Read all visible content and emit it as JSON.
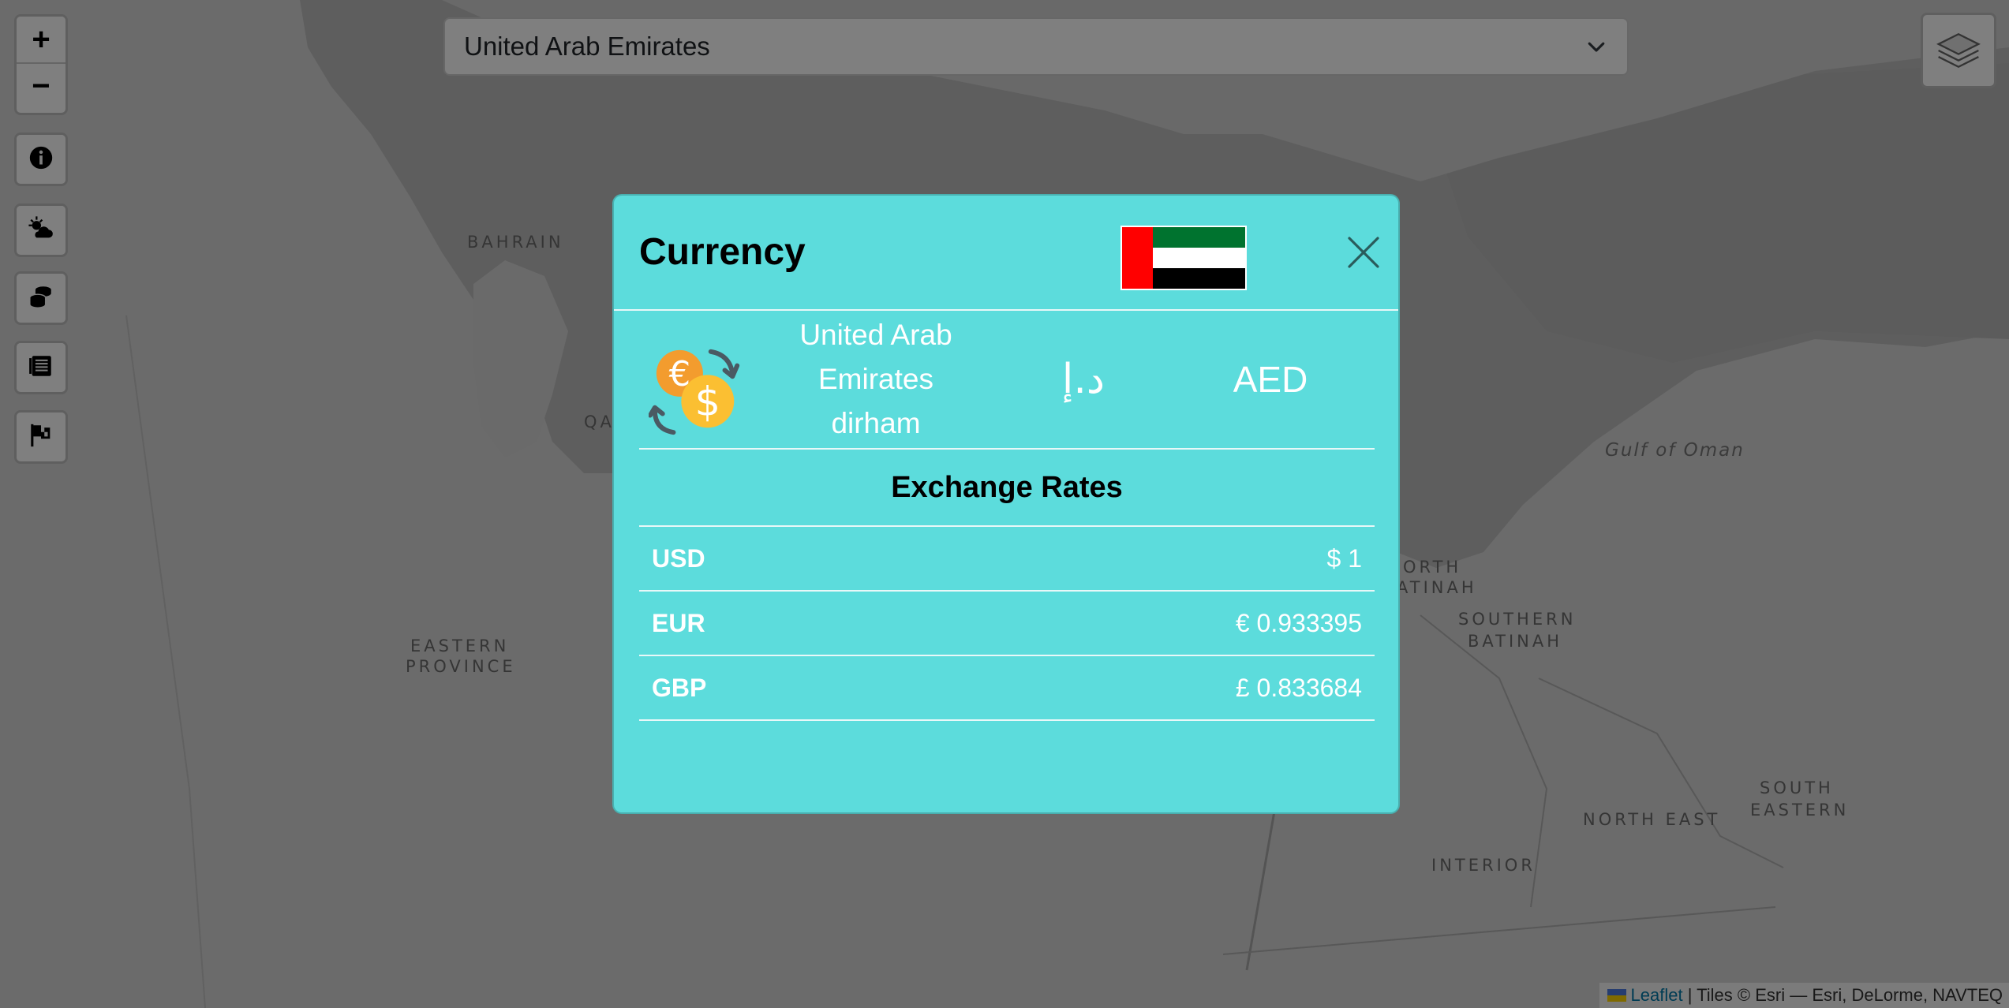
{
  "map": {
    "labels": {
      "bahrain": "BAHRAIN",
      "qatar": "QA",
      "eastern_province_1": "EASTERN",
      "eastern_province_2": "PROVINCE",
      "gulf_of_oman": "Gulf of Oman",
      "north_batinah_1": "ORTH",
      "north_batinah_2": "ATINAH",
      "south_batinah_1": "SOUTHERN",
      "south_batinah_2": "BATINAH",
      "north_east": "NORTH EAST",
      "interior": "INTERIOR",
      "south_eastern_1": "SOUTH",
      "south_eastern_2": "EASTERN"
    },
    "colors": {
      "land": "#d4d4d4",
      "water": "#bfbfbf",
      "border": "#aaaaaa"
    }
  },
  "controls": {
    "zoom_in": "+",
    "zoom_out": "−",
    "buttons": [
      "info-icon",
      "weather-icon",
      "coins-stack-icon",
      "news-icon",
      "flag-icon"
    ]
  },
  "country_select": {
    "value": "United Arab Emirates"
  },
  "attribution": {
    "leaflet": "Leaflet",
    "tiles": "| Tiles © Esri — Esri, DeLorme, NAVTEQ"
  },
  "modal": {
    "title": "Currency",
    "flag_colors": {
      "red": "#ff0000",
      "green": "#00732f",
      "white": "#ffffff",
      "black": "#000000"
    },
    "currency": {
      "name": "United Arab Emirates dirham",
      "symbol": "د.إ",
      "code": "AED"
    },
    "rates_title": "Exchange Rates",
    "rates": [
      {
        "code": "USD",
        "value": "$ 1"
      },
      {
        "code": "EUR",
        "value": "€ 0.933395"
      },
      {
        "code": "GBP",
        "value": "£ 0.833684"
      }
    ],
    "background": "#5cdcdc"
  }
}
